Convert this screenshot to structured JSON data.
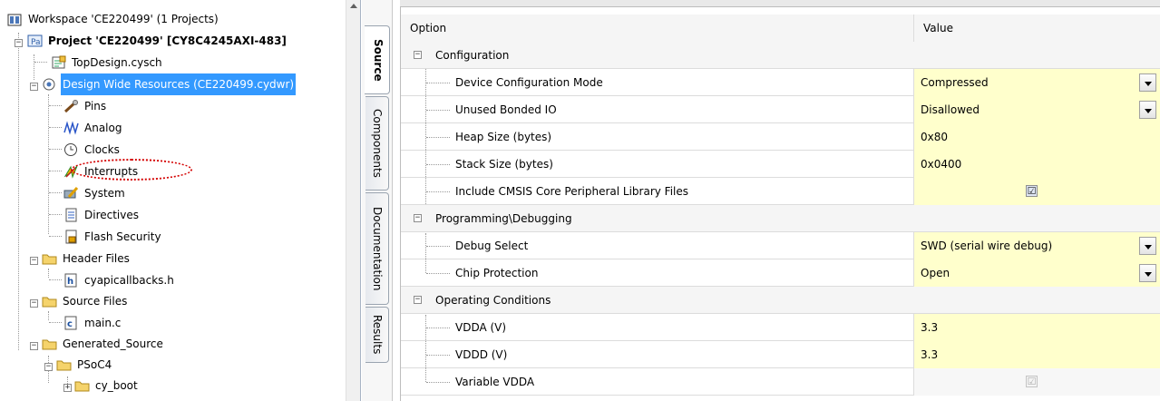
{
  "tree": {
    "workspace": "Workspace 'CE220499' (1 Projects)",
    "project": "Project  'CE220499' [CY8C4245AXI-483]",
    "items": [
      {
        "label": "TopDesign.cysch",
        "icon": "schematic-icon"
      },
      {
        "label": "Design Wide Resources (CE220499.cydwr)",
        "icon": "dwr-icon"
      },
      {
        "label": "Pins",
        "icon": "pins-icon"
      },
      {
        "label": "Analog",
        "icon": "analog-icon"
      },
      {
        "label": "Clocks",
        "icon": "clock-icon"
      },
      {
        "label": "Interrupts",
        "icon": "interrupts-icon"
      },
      {
        "label": "System",
        "icon": "system-icon"
      },
      {
        "label": "Directives",
        "icon": "directives-icon"
      },
      {
        "label": "Flash Security",
        "icon": "flash-security-icon"
      },
      {
        "label": "Header Files",
        "icon": "folder-icon"
      },
      {
        "label": "cyapicallbacks.h",
        "icon": "header-file-icon"
      },
      {
        "label": "Source Files",
        "icon": "folder-icon"
      },
      {
        "label": "main.c",
        "icon": "c-file-icon"
      },
      {
        "label": "Generated_Source",
        "icon": "folder-icon"
      },
      {
        "label": "PSoC4",
        "icon": "folder-icon"
      },
      {
        "label": "cy_boot",
        "icon": "folder-icon"
      }
    ]
  },
  "tabs": [
    "Source",
    "Components",
    "Documentation",
    "Results"
  ],
  "grid": {
    "header": {
      "option": "Option",
      "value": "Value"
    },
    "categories": [
      {
        "label": "Configuration"
      },
      {
        "label": "Programming\\Debugging"
      },
      {
        "label": "Operating Conditions"
      }
    ],
    "rows": [
      {
        "option": "Device Configuration Mode",
        "value": "Compressed"
      },
      {
        "option": "Unused Bonded IO",
        "value": "Disallowed"
      },
      {
        "option": "Heap Size (bytes)",
        "value": "0x80"
      },
      {
        "option": "Stack Size (bytes)",
        "value": "0x0400"
      },
      {
        "option": "Include CMSIS Core Peripheral Library Files",
        "value": ""
      },
      {
        "option": "Debug Select",
        "value": "SWD (serial wire debug)"
      },
      {
        "option": "Chip Protection",
        "value": "Open"
      },
      {
        "option": "VDDA (V)",
        "value": "3.3"
      },
      {
        "option": "VDDD (V)",
        "value": "3.3"
      },
      {
        "option": "Variable VDDA",
        "value": ""
      }
    ],
    "checks": {
      "cmsis": "☑",
      "variable_vdda": "☑"
    }
  },
  "colors": {
    "selection": "#3399ff",
    "value_bg": "#ffffcc",
    "annotation": "#d40000"
  }
}
